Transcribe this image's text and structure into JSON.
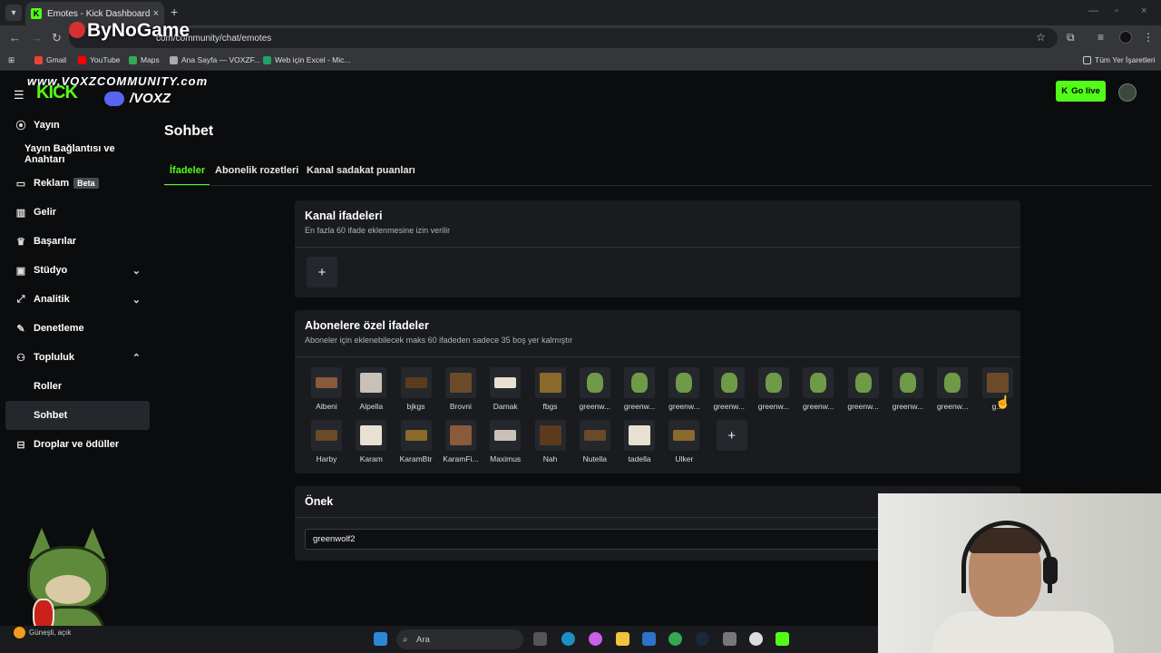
{
  "browser": {
    "tab_title": "Emotes - Kick Dashboard",
    "url_visible": "com/community/chat/emotes",
    "bookmarks": [
      "Gmail",
      "YouTube",
      "Maps",
      "Ana Sayfa — VOXZF...",
      "Web için Excel - Mic...",
      "Tüm Yer İşaretleri"
    ]
  },
  "overlay": {
    "watermark": "ByNoGame",
    "vox_url": "www.VOXZCOMMUNITY.com",
    "vox_name": "/VOXZ"
  },
  "header": {
    "logo": "KICK",
    "go_live": "Go live"
  },
  "sidebar": {
    "items": [
      {
        "label": "Yayın",
        "icon": "broadcast-icon"
      },
      {
        "label": "Yayın Bağlantısı ve Anahtarı"
      },
      {
        "label": "Reklam",
        "icon": "ad-icon",
        "badge": "Beta"
      },
      {
        "label": "Gelir",
        "icon": "revenue-icon"
      },
      {
        "label": "Başarılar",
        "icon": "trophy-icon"
      },
      {
        "label": "Stüdyo",
        "icon": "studio-icon"
      },
      {
        "label": "Analitik",
        "icon": "analytics-icon"
      },
      {
        "label": "Denetleme",
        "icon": "wrench-icon"
      },
      {
        "label": "Topluluk",
        "icon": "community-icon"
      },
      {
        "label": "Roller"
      },
      {
        "label": "Sohbet"
      },
      {
        "label": "Droplar ve ödüller",
        "icon": "drops-icon"
      }
    ]
  },
  "page": {
    "title": "Sohbet",
    "tabs": [
      "İfadeler",
      "Abonelik rozetleri",
      "Kanal sadakat puanları"
    ]
  },
  "channel_emotes": {
    "title": "Kanal ifadeleri",
    "subtitle": "En fazla 60 ifade eklenmesine izin verilir",
    "add_label": "+"
  },
  "sub_emotes": {
    "title": "Abonelere özel ifadeler",
    "subtitle": "Aboneler için eklenebilecek maks 60 ifadeden sadece 35 boş yer kalmıştır",
    "row1": [
      "Albeni",
      "Alpella",
      "bjkgs",
      "Brovni",
      "Damak",
      "fbgs",
      "greenw...",
      "greenw...",
      "greenw...",
      "greenw...",
      "greenw...",
      "greenw...",
      "greenw...",
      "greenw...",
      "greenw...",
      "g..."
    ],
    "row2": [
      "Harby",
      "Karam",
      "KaramBtr",
      "KaramFi...",
      "Maximus",
      "Nah",
      "Nutella",
      "tadella",
      "Ulker"
    ],
    "add_label": "+"
  },
  "prefix": {
    "title": "Önek",
    "value": "greenwolf2"
  },
  "taskbar": {
    "search_placeholder": "Ara",
    "weather": "Güneşli, açık"
  },
  "colors": {
    "accent": "#53fc18",
    "card": "#191b1f",
    "background": "#0b0c0e"
  }
}
